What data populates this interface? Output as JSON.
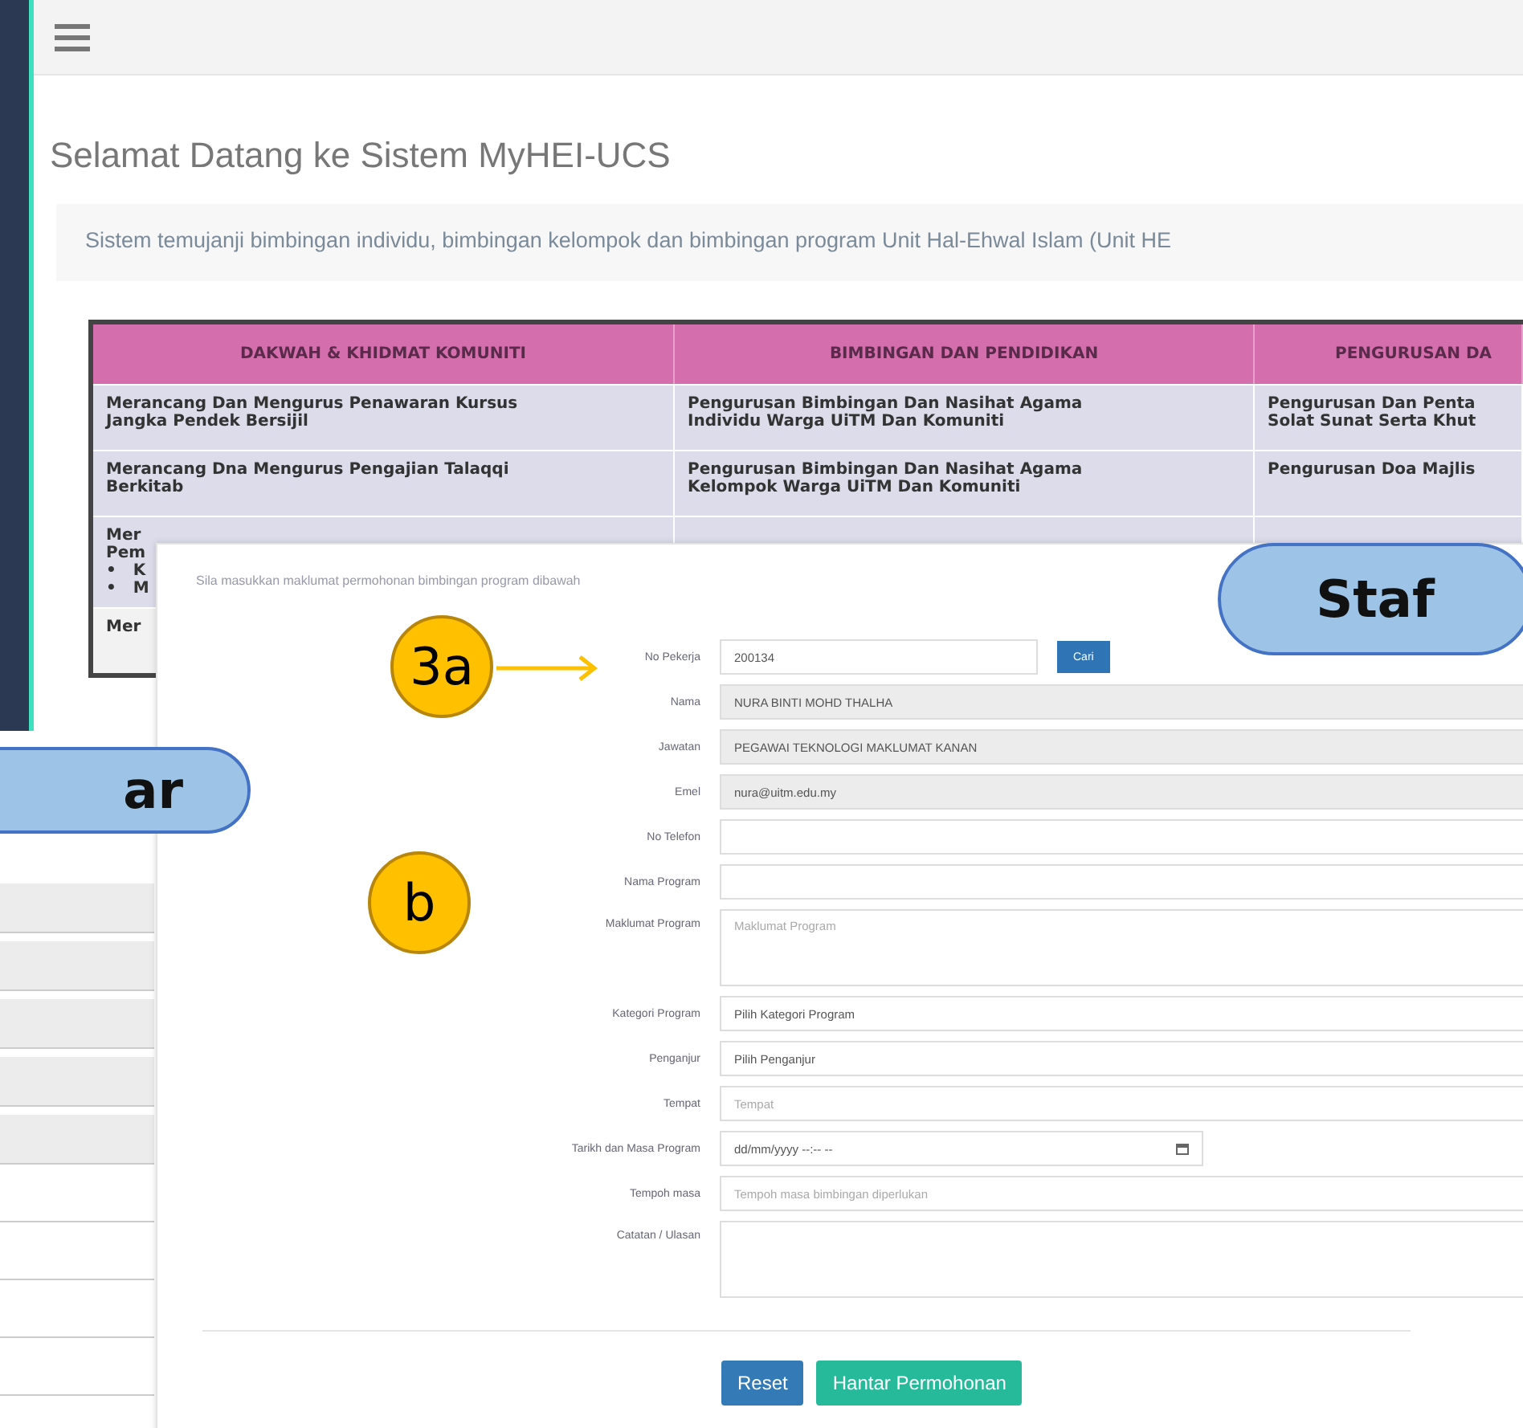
{
  "title": "Selamat Datang ke Sistem MyHEI-UCS",
  "description": "Sistem temujanji bimbingan individu, bimbingan kelompok dan bimbingan program Unit Hal-Ehwal Islam (Unit HE",
  "table": {
    "columns": [
      "DAKWAH & KHIDMAT KOMUNITI",
      "BIMBINGAN DAN PENDIDIKAN",
      "PENGURUSAN DA"
    ],
    "rows": [
      {
        "cells": [
          "Merancang Dan Mengurus Penawaran Kursus\nJangka Pendek Bersijil",
          "Pengurusan Bimbingan Dan Nasihat Agama\nIndividu Warga UiTM Dan Komuniti",
          "Pengurusan Dan Penta\nSolat Sunat Serta Khut"
        ]
      },
      {
        "cells": [
          "Merancang Dna Mengurus Pengajian Talaqqi\nBerkitab",
          "Pengurusan Bimbingan Dan Nasihat Agama\nKelompok Warga UiTM Dan Komuniti",
          "Pengurusan Doa Majlis"
        ]
      },
      {
        "cells": [
          "Mer\nPem\n•   K\n•   M"
        ]
      },
      {
        "cells": [
          "Mer"
        ]
      }
    ]
  },
  "form": {
    "intro": "Sila masukkan maklumat permohonan bimbingan program dibawah",
    "fields": [
      {
        "label": "No Pekerja",
        "kind": "search",
        "value": "200134",
        "button": "Cari"
      },
      {
        "label": "Nama",
        "kind": "readonly",
        "value": "NURA BINTI MOHD THALHA"
      },
      {
        "label": "Jawatan",
        "kind": "readonly",
        "value": "PEGAWAI TEKNOLOGI MAKLUMAT KANAN"
      },
      {
        "label": "Emel",
        "kind": "readonly",
        "value": "nura@uitm.edu.my"
      },
      {
        "label": "No Telefon",
        "kind": "text"
      },
      {
        "label": "Nama Program",
        "kind": "text"
      },
      {
        "label": "Maklumat Program",
        "kind": "textarea",
        "placeholder": "Maklumat Program"
      },
      {
        "label": "Kategori Program",
        "kind": "select",
        "value": "Pilih Kategori Program"
      },
      {
        "label": "Penganjur",
        "kind": "select",
        "value": "Pilih Penganjur"
      },
      {
        "label": "Tempat",
        "kind": "text",
        "placeholder": "Tempat"
      },
      {
        "label": "Tarikh dan Masa Program",
        "kind": "datetime",
        "value": "dd/mm/yyyy --:-- --"
      },
      {
        "label": "Tempoh masa",
        "kind": "text",
        "placeholder": "Tempoh masa bimbingan diperlukan"
      },
      {
        "label": "Catatan / Ulasan",
        "kind": "textarea"
      }
    ],
    "buttons": [
      {
        "label": "Reset",
        "kind": "primary"
      },
      {
        "label": "Hantar Permohonan",
        "kind": "success"
      }
    ]
  },
  "callouts": [
    {
      "text": "3a",
      "kind": "circle-arrow"
    },
    {
      "text": "b",
      "kind": "circle"
    },
    {
      "text": "Staf",
      "kind": "pill"
    },
    {
      "text": "ar",
      "kind": "pill"
    }
  ]
}
